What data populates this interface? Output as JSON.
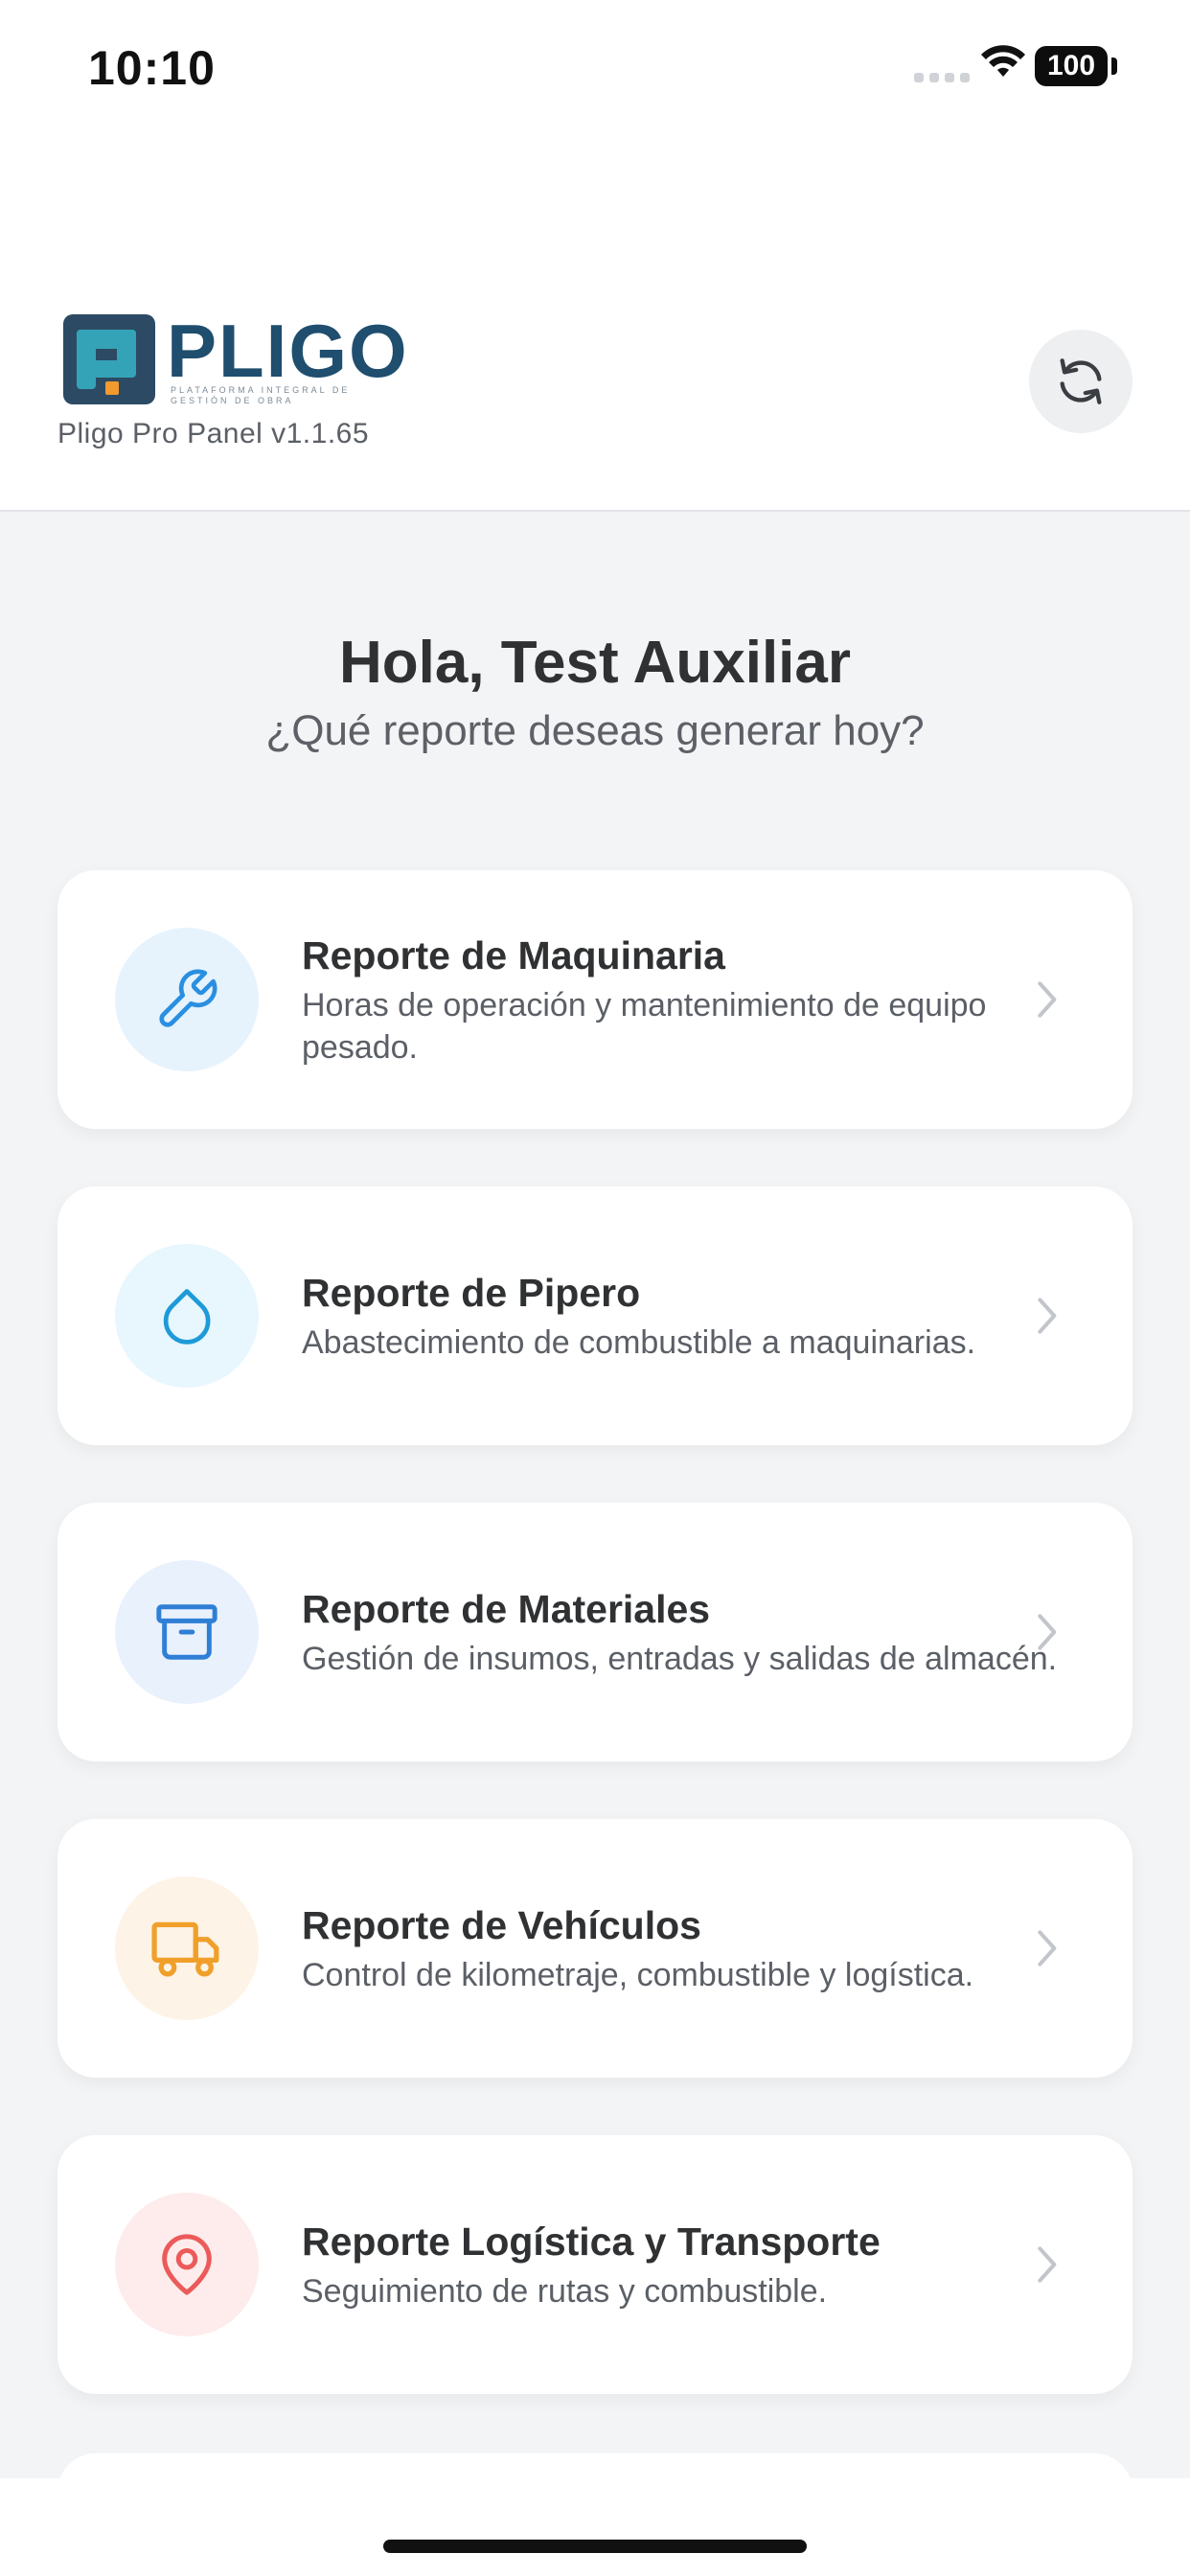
{
  "status_bar": {
    "time": "10:10",
    "battery": "100"
  },
  "header": {
    "logo_word": "PLIGO",
    "logo_tagline": "PLATAFORMA INTEGRAL DE GESTIÓN DE OBRA",
    "version": "Pligo Pro Panel v1.1.65",
    "refresh_icon": "refresh-icon"
  },
  "greeting": {
    "title": "Hola, Test Auxiliar",
    "subtitle": "¿Qué reporte deseas generar hoy?"
  },
  "reports": [
    {
      "title": "Reporte de Maquinaria",
      "description": "Horas de operación y mantenimiento de equipo pesado.",
      "icon": "wrench-icon",
      "icon_color": "#2a8fe0",
      "icon_bg": "#e6f3fd"
    },
    {
      "title": "Reporte de Pipero",
      "description": "Abastecimiento de combustible a maquinarias.",
      "icon": "droplet-icon",
      "icon_color": "#1d9ad8",
      "icon_bg": "#e8f6fd"
    },
    {
      "title": "Reporte de Materiales",
      "description": "Gestión de insumos, entradas y salidas de almacén.",
      "icon": "archive-box-icon",
      "icon_color": "#2f7fd6",
      "icon_bg": "#e8f1fc"
    },
    {
      "title": "Reporte de Vehículos",
      "description": "Control de kilometraje, combustible y logística.",
      "icon": "truck-icon",
      "icon_color": "#f0a02a",
      "icon_bg": "#fdf3e6"
    },
    {
      "title": "Reporte Logística y Transporte",
      "description": "Seguimiento de rutas y combustible.",
      "icon": "map-pin-icon",
      "icon_color": "#ec5a5a",
      "icon_bg": "#fdeceb"
    }
  ]
}
